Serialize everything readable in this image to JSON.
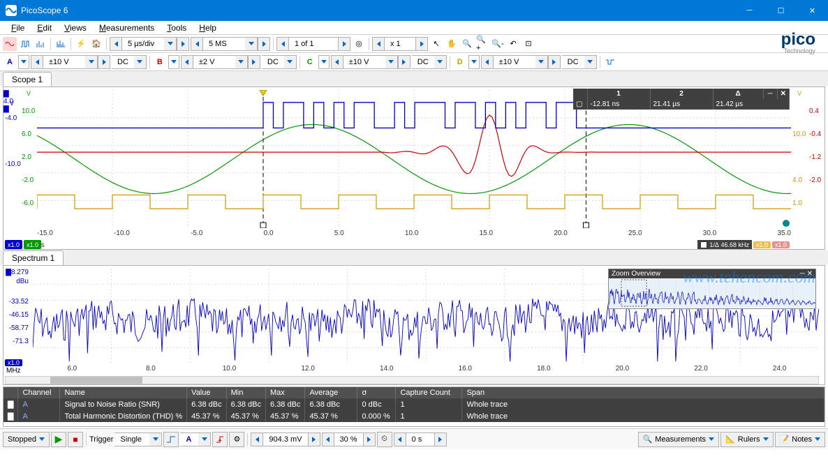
{
  "window": {
    "title": "PicoScope 6"
  },
  "menu": {
    "file": "File",
    "edit": "Edit",
    "views": "Views",
    "measurements": "Measurements",
    "tools": "Tools",
    "help": "Help"
  },
  "tb1": {
    "timebase": "5 µs/div",
    "samples": "5 MS",
    "page": "1 of 1",
    "zoom": "x 1"
  },
  "channels": {
    "a": {
      "label": "A",
      "range": "±10 V",
      "coupling": "DC",
      "color": "#0000cc"
    },
    "b": {
      "label": "B",
      "range": "±2 V",
      "coupling": "DC",
      "color": "#cc0000"
    },
    "c": {
      "label": "C",
      "range": "±10 V",
      "coupling": "DC",
      "color": "#009900"
    },
    "d": {
      "label": "D",
      "range": "±10 V",
      "coupling": "DC",
      "color": "#cc9900"
    }
  },
  "scope": {
    "tab": "Scope 1",
    "yaxis_a": {
      "unit": "V",
      "ticks": [
        "4.0",
        "",
        "-4.0",
        "",
        "-10.0",
        ""
      ]
    },
    "yaxis_c": {
      "unit": "V",
      "ticks": [
        "",
        "10.0",
        "6.0",
        "2.0",
        "-2.0",
        "-6.0"
      ]
    },
    "yaxis_d": {
      "unit": "V",
      "ticks": [
        "",
        "",
        "10.0",
        "",
        "4.0",
        "1.0"
      ]
    },
    "yaxis_b": {
      "unit": "V",
      "ticks": [
        "",
        "0.4",
        "-0.4",
        "-1.2",
        "-2.0",
        ""
      ]
    },
    "xaxis": {
      "unit": "µs",
      "ticks": [
        "-15.0",
        "-10.0",
        "-5.0",
        "0.0",
        "5.0",
        "10.0",
        "15.0",
        "20.0",
        "25.0",
        "30.0",
        "35.0"
      ]
    },
    "badges": {
      "x1a": "x1.0",
      "x1c": "x1.0",
      "x1d": "x1.0",
      "x1b": "x1.0"
    },
    "rulers": {
      "col1": "1",
      "col2": "2",
      "coldelta": "Δ",
      "v1": "-12.81 ns",
      "v2": "21.41 µs",
      "vd": "21.42 µs",
      "freq_label": "1/Δ",
      "freq": "46.68 kHz"
    }
  },
  "spectrum": {
    "tab": "Spectrum 1",
    "yaxis": {
      "unit": "dBu",
      "ticks": [
        "8.279",
        "",
        "-33.52",
        "-46.15",
        "-58.77",
        "-71.3"
      ]
    },
    "xaxis": {
      "unit": "MHz",
      "ticks": [
        "6.0",
        "8.0",
        "10.0",
        "12.0",
        "14.0",
        "16.0",
        "18.0",
        "20.0",
        "22.0",
        "24.0"
      ]
    },
    "badge": "x1.0",
    "zoom_title": "Zoom Overview"
  },
  "measurements": {
    "headers": {
      "ch": "Channel",
      "name": "Name",
      "value": "Value",
      "min": "Min",
      "max": "Max",
      "avg": "Average",
      "sigma": "σ",
      "count": "Capture Count",
      "span": "Span"
    },
    "rows": [
      {
        "ch": "A",
        "name": "Signal to Noise Ratio (SNR)",
        "value": "6.38 dBc",
        "min": "6.38 dBc",
        "max": "6.38 dBc",
        "avg": "6.38 dBc",
        "sigma": "0 dBc",
        "count": "1",
        "span": "Whole trace"
      },
      {
        "ch": "A",
        "name": "Total Harmonic Distortion (THD) %",
        "value": "45.37 %",
        "min": "45.37 %",
        "max": "45.37 %",
        "avg": "45.37 %",
        "sigma": "0.000 %",
        "count": "1",
        "span": "Whole trace"
      }
    ]
  },
  "status": {
    "label": "Stopped",
    "trigger": "Trigger",
    "trigmode": "Single",
    "trigch": "A",
    "level": "904.3 mV",
    "pretrig": "30 %",
    "posttrig": "0 s",
    "measurements": "Measurements",
    "rulers": "Rulers",
    "notes": "Notes"
  },
  "watermark": "www.tehencom.com",
  "brand": {
    "name": "pico",
    "sub": "Technology"
  },
  "chart_data": {
    "scope": {
      "type": "line",
      "xlabel": "µs",
      "x_range": [
        -15,
        35
      ],
      "series": [
        {
          "name": "A",
          "color": "#0000cc",
          "descr": "square pulse train, low -6 V, high 14 V, period ≈ 2.5 µs, between -12.8 ns and 21.4 µs irregular gating"
        },
        {
          "name": "B",
          "color": "#cc0000",
          "descr": "damped transient at ~15 µs, baseline 0 V, peak +1.1 V, duration ~4 µs"
        },
        {
          "name": "C",
          "color": "#009900",
          "descr": "sine, amplitude ~4 V, offset 0 V, period ~21 µs"
        },
        {
          "name": "D",
          "color": "#cc9900",
          "descr": "square wave, low 1 V, high 4 V, period ~5 µs"
        }
      ]
    },
    "spectrum": {
      "type": "line",
      "xlabel": "MHz",
      "x_range": [
        5,
        25
      ],
      "ylabel": "dBu",
      "y_range": [
        -71.3,
        8.3
      ],
      "series": [
        {
          "name": "A",
          "color": "#0000cc",
          "descr": "dense noise spectrum, average -40 dBu with ±15 dBu fluctuation across band"
        }
      ]
    }
  }
}
